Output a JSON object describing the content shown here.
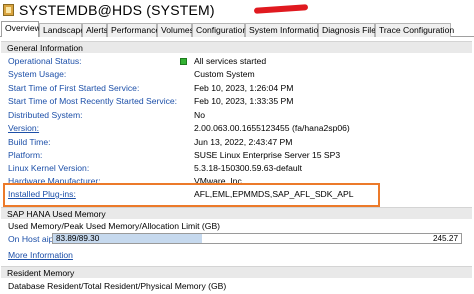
{
  "window": {
    "title": "SYSTEMDB@HDS (SYSTEM)",
    "icon": "database-icon"
  },
  "tabs": [
    {
      "label": "Overview",
      "active": true
    },
    {
      "label": "Landscape",
      "active": false
    },
    {
      "label": "Alerts",
      "active": false
    },
    {
      "label": "Performance",
      "active": false
    },
    {
      "label": "Volumes",
      "active": false
    },
    {
      "label": "Configuration",
      "active": false
    },
    {
      "label": "System Information",
      "active": false
    },
    {
      "label": "Diagnosis Files",
      "active": false
    },
    {
      "label": "Trace Configuration",
      "active": false
    }
  ],
  "general_information": {
    "header": "General Information",
    "rows": [
      {
        "label": "Operational Status:",
        "value": "All services started",
        "status_color": "#33b233"
      },
      {
        "label": "System Usage:",
        "value": "Custom System"
      },
      {
        "label": "Start Time of First Started Service:",
        "value": "Feb 10, 2023, 1:26:04 PM"
      },
      {
        "label": "Start Time of Most Recently Started Service:",
        "value": "Feb 10, 2023, 1:33:35 PM"
      },
      {
        "label": "Distributed System:",
        "value": "No"
      },
      {
        "label": "Version:",
        "value": "2.00.063.00.1655123455 (fa/hana2sp06)"
      },
      {
        "label": "Build Time:",
        "value": "Jun 13, 2022, 2:43:47 PM"
      },
      {
        "label": "Platform:",
        "value": "SUSE Linux Enterprise Server 15 SP3"
      },
      {
        "label": "Linux Kernel Version:",
        "value": "5.3.18-150300.59.63-default"
      },
      {
        "label": "Hardware Manufacturer:",
        "value": "VMware, Inc."
      },
      {
        "label": "Installed Plug-ins:",
        "value": "AFL,EML,EPMMDS,SAP_AFL_SDK_APL"
      }
    ]
  },
  "used_memory": {
    "header": "SAP HANA Used Memory",
    "caption": "Used Memory/Peak Used Memory/Allocation Limit (GB)",
    "host_label": "On Host aiplhdqs:",
    "used_text": "83.89/89.30",
    "limit_text": "245.27",
    "used_fraction": 0.364,
    "more_link": "More Information"
  },
  "resident_memory": {
    "header": "Resident Memory",
    "caption": "Database Resident/Total Resident/Physical Memory (GB)"
  },
  "colors": {
    "link": "#1c4fa8",
    "highlight": "#ec7a2a",
    "redaction": "#e0191f",
    "bar_fill": "#c6d9ee"
  }
}
